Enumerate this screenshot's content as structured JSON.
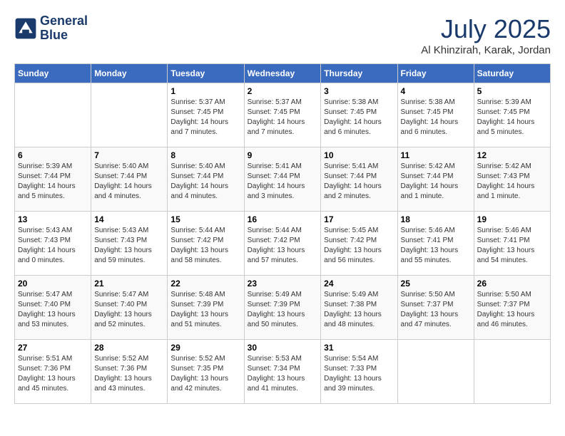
{
  "header": {
    "logo_line1": "General",
    "logo_line2": "Blue",
    "month_year": "July 2025",
    "location": "Al Khinzirah, Karak, Jordan"
  },
  "weekdays": [
    "Sunday",
    "Monday",
    "Tuesday",
    "Wednesday",
    "Thursday",
    "Friday",
    "Saturday"
  ],
  "weeks": [
    [
      {
        "day": "",
        "info": ""
      },
      {
        "day": "",
        "info": ""
      },
      {
        "day": "1",
        "info": "Sunrise: 5:37 AM\nSunset: 7:45 PM\nDaylight: 14 hours and 7 minutes."
      },
      {
        "day": "2",
        "info": "Sunrise: 5:37 AM\nSunset: 7:45 PM\nDaylight: 14 hours and 7 minutes."
      },
      {
        "day": "3",
        "info": "Sunrise: 5:38 AM\nSunset: 7:45 PM\nDaylight: 14 hours and 6 minutes."
      },
      {
        "day": "4",
        "info": "Sunrise: 5:38 AM\nSunset: 7:45 PM\nDaylight: 14 hours and 6 minutes."
      },
      {
        "day": "5",
        "info": "Sunrise: 5:39 AM\nSunset: 7:45 PM\nDaylight: 14 hours and 5 minutes."
      }
    ],
    [
      {
        "day": "6",
        "info": "Sunrise: 5:39 AM\nSunset: 7:44 PM\nDaylight: 14 hours and 5 minutes."
      },
      {
        "day": "7",
        "info": "Sunrise: 5:40 AM\nSunset: 7:44 PM\nDaylight: 14 hours and 4 minutes."
      },
      {
        "day": "8",
        "info": "Sunrise: 5:40 AM\nSunset: 7:44 PM\nDaylight: 14 hours and 4 minutes."
      },
      {
        "day": "9",
        "info": "Sunrise: 5:41 AM\nSunset: 7:44 PM\nDaylight: 14 hours and 3 minutes."
      },
      {
        "day": "10",
        "info": "Sunrise: 5:41 AM\nSunset: 7:44 PM\nDaylight: 14 hours and 2 minutes."
      },
      {
        "day": "11",
        "info": "Sunrise: 5:42 AM\nSunset: 7:44 PM\nDaylight: 14 hours and 1 minute."
      },
      {
        "day": "12",
        "info": "Sunrise: 5:42 AM\nSunset: 7:43 PM\nDaylight: 14 hours and 1 minute."
      }
    ],
    [
      {
        "day": "13",
        "info": "Sunrise: 5:43 AM\nSunset: 7:43 PM\nDaylight: 14 hours and 0 minutes."
      },
      {
        "day": "14",
        "info": "Sunrise: 5:43 AM\nSunset: 7:43 PM\nDaylight: 13 hours and 59 minutes."
      },
      {
        "day": "15",
        "info": "Sunrise: 5:44 AM\nSunset: 7:42 PM\nDaylight: 13 hours and 58 minutes."
      },
      {
        "day": "16",
        "info": "Sunrise: 5:44 AM\nSunset: 7:42 PM\nDaylight: 13 hours and 57 minutes."
      },
      {
        "day": "17",
        "info": "Sunrise: 5:45 AM\nSunset: 7:42 PM\nDaylight: 13 hours and 56 minutes."
      },
      {
        "day": "18",
        "info": "Sunrise: 5:46 AM\nSunset: 7:41 PM\nDaylight: 13 hours and 55 minutes."
      },
      {
        "day": "19",
        "info": "Sunrise: 5:46 AM\nSunset: 7:41 PM\nDaylight: 13 hours and 54 minutes."
      }
    ],
    [
      {
        "day": "20",
        "info": "Sunrise: 5:47 AM\nSunset: 7:40 PM\nDaylight: 13 hours and 53 minutes."
      },
      {
        "day": "21",
        "info": "Sunrise: 5:47 AM\nSunset: 7:40 PM\nDaylight: 13 hours and 52 minutes."
      },
      {
        "day": "22",
        "info": "Sunrise: 5:48 AM\nSunset: 7:39 PM\nDaylight: 13 hours and 51 minutes."
      },
      {
        "day": "23",
        "info": "Sunrise: 5:49 AM\nSunset: 7:39 PM\nDaylight: 13 hours and 50 minutes."
      },
      {
        "day": "24",
        "info": "Sunrise: 5:49 AM\nSunset: 7:38 PM\nDaylight: 13 hours and 48 minutes."
      },
      {
        "day": "25",
        "info": "Sunrise: 5:50 AM\nSunset: 7:37 PM\nDaylight: 13 hours and 47 minutes."
      },
      {
        "day": "26",
        "info": "Sunrise: 5:50 AM\nSunset: 7:37 PM\nDaylight: 13 hours and 46 minutes."
      }
    ],
    [
      {
        "day": "27",
        "info": "Sunrise: 5:51 AM\nSunset: 7:36 PM\nDaylight: 13 hours and 45 minutes."
      },
      {
        "day": "28",
        "info": "Sunrise: 5:52 AM\nSunset: 7:36 PM\nDaylight: 13 hours and 43 minutes."
      },
      {
        "day": "29",
        "info": "Sunrise: 5:52 AM\nSunset: 7:35 PM\nDaylight: 13 hours and 42 minutes."
      },
      {
        "day": "30",
        "info": "Sunrise: 5:53 AM\nSunset: 7:34 PM\nDaylight: 13 hours and 41 minutes."
      },
      {
        "day": "31",
        "info": "Sunrise: 5:54 AM\nSunset: 7:33 PM\nDaylight: 13 hours and 39 minutes."
      },
      {
        "day": "",
        "info": ""
      },
      {
        "day": "",
        "info": ""
      }
    ]
  ]
}
